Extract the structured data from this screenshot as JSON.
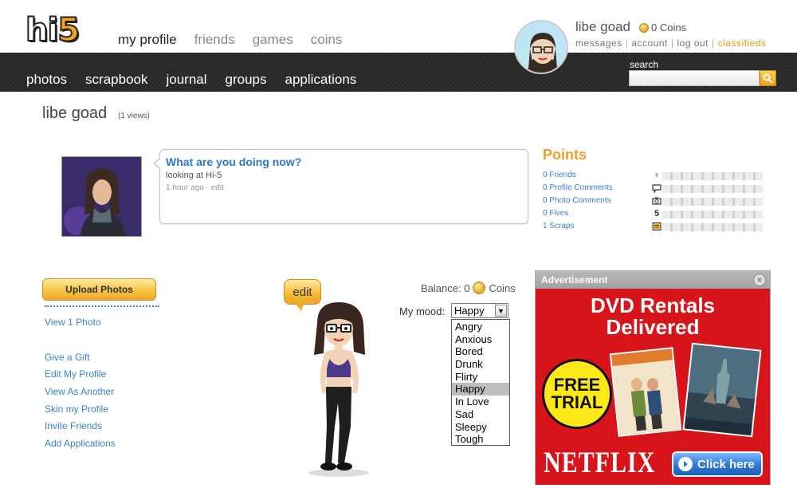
{
  "brand": {
    "logo_hi": "hi",
    "logo_five": "5"
  },
  "top_tabs": [
    {
      "label": "my profile",
      "active": true
    },
    {
      "label": "friends",
      "active": false
    },
    {
      "label": "games",
      "active": false
    },
    {
      "label": "coins",
      "active": false
    }
  ],
  "user": {
    "name": "libe goad",
    "coins": "0 Coins",
    "links": [
      "messages",
      "account",
      "log out",
      "classifieds"
    ]
  },
  "nav": [
    "photos",
    "scrapbook",
    "journal",
    "groups",
    "applications"
  ],
  "search": {
    "label": "search",
    "value": ""
  },
  "profile": {
    "name": "libe goad",
    "views": "(1 views)"
  },
  "status": {
    "question": "What are you doing now?",
    "text": "looking at Hi-5",
    "time": "1 hour ago",
    "edit": "edit",
    "separator": "·"
  },
  "points": {
    "title": "Points",
    "rows": [
      {
        "label": "0 Friends",
        "icon": "person-icon",
        "glyph": "♀"
      },
      {
        "label": "0 Profile Comments",
        "icon": "speech-bubble-icon",
        "glyph": "💬"
      },
      {
        "label": "0 Photo Comments",
        "icon": "camera-icon",
        "glyph": "◙"
      },
      {
        "label": "0 Fives",
        "icon": "five-icon",
        "glyph": "5"
      },
      {
        "label": "1 Scraps",
        "icon": "scrapbook-icon",
        "glyph": "▤"
      }
    ]
  },
  "sidebar": {
    "upload": "Upload Photos",
    "view_photo": "View 1 Photo",
    "links": [
      "Give a Gift",
      "Edit My Profile",
      "View As Another",
      "Skin my Profile",
      "Invite Friends",
      "Add Applications"
    ]
  },
  "avatar": {
    "edit_label": "edit"
  },
  "balance": {
    "prefix": "Balance: 0",
    "unit": "Coins"
  },
  "mood": {
    "label": "My mood:",
    "selected": "Happy",
    "options": [
      "Angry",
      "Anxious",
      "Bored",
      "Drunk",
      "Flirty",
      "Happy",
      "In Love",
      "Sad",
      "Sleepy",
      "Tough"
    ]
  },
  "ad": {
    "label": "Advertisement",
    "close": "×",
    "title_line1": "DVD Rentals",
    "title_line2": "Delivered",
    "badge_line1": "FREE",
    "badge_line2": "TRIAL",
    "brand": "NETFLIX",
    "cta": "Click here"
  },
  "colors": {
    "accent_orange": "#f0a024",
    "link_blue": "#3a83c8",
    "nav_dark": "#262626",
    "ad_red": "#d8141b"
  }
}
